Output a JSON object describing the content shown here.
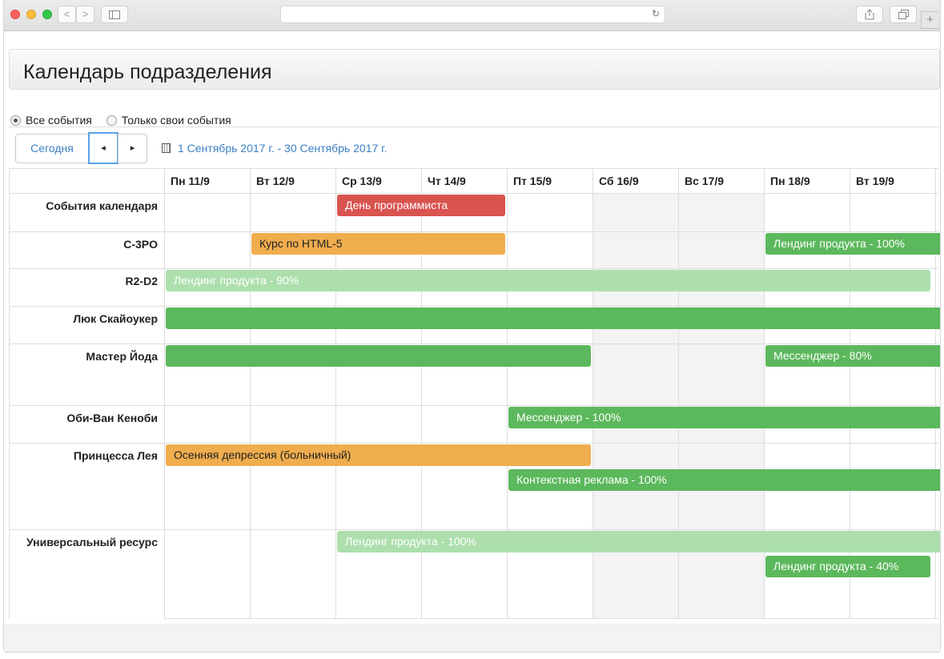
{
  "browser": {
    "url": "",
    "back_label": "<",
    "forward_label": ">",
    "new_tab_label": "+"
  },
  "page": {
    "title": "Календарь подразделения"
  },
  "filters": {
    "all_events": "Все события",
    "own_events": "Только свои события",
    "selected": "all_events"
  },
  "nav": {
    "today": "Сегодня",
    "prev": "◂",
    "next": "▸",
    "range": "1 Сентябрь 2017 г. - 30 Сентябрь 2017 г."
  },
  "calendar": {
    "days": [
      "Пн 11/9",
      "Вт 12/9",
      "Ср 13/9",
      "Чт 14/9",
      "Пт 15/9",
      "Сб 16/9",
      "Вс 17/9",
      "Пн 18/9",
      "Вт 19/9"
    ],
    "weekend_days": [
      "Сб 16/9",
      "Вс 17/9"
    ],
    "resources": [
      "События календаря",
      "C-3PO",
      "R2-D2",
      "Люк Скайоукер",
      "Мастер Йода",
      "Оби-Ван Кеноби",
      "Принцесса Лея",
      "Универсальный ресурс"
    ],
    "events": [
      {
        "resource": "События календаря",
        "title": "День программиста",
        "start": "Ср 13/9",
        "end": "Чт 14/9",
        "color": "#d9534f"
      },
      {
        "resource": "C-3PO",
        "title": "Курс по HTML-5",
        "start": "Вт 12/9",
        "end": "Чт 14/9",
        "color": "#f0ad4e"
      },
      {
        "resource": "C-3PO",
        "title": "Лендинг продукта - 100%",
        "start": "Пн 18/9",
        "end": "Вт 19/9",
        "continues": true,
        "color": "#5cb85c"
      },
      {
        "resource": "R2-D2",
        "title": "Лендинг продукта - 90%",
        "start": "Пн 11/9",
        "end": "Вт 19/9",
        "color": "#addfad"
      },
      {
        "resource": "Люк Скайоукер",
        "title": "",
        "start": "Пн 11/9",
        "end": "Вт 19/9",
        "continues": true,
        "color": "#5cb85c"
      },
      {
        "resource": "Мастер Йода",
        "title": "",
        "start": "Пн 11/9",
        "end": "Пт 15/9",
        "color": "#5cb85c"
      },
      {
        "resource": "Мастер Йода",
        "title": "Мессенджер - 80%",
        "start": "Пн 18/9",
        "end": "Вт 19/9",
        "continues": true,
        "color": "#5cb85c"
      },
      {
        "resource": "Оби-Ван Кеноби",
        "title": "Мессенджер - 100%",
        "start": "Пт 15/9",
        "end": "Вт 19/9",
        "continues": true,
        "color": "#5cb85c"
      },
      {
        "resource": "Принцесса Лея",
        "title": "Осенняя депрессия (больничный)",
        "start": "Пн 11/9",
        "end": "Пт 15/9",
        "color": "#f0ad4e"
      },
      {
        "resource": "Принцесса Лея",
        "title": "Контекстная реклама - 100%",
        "start": "Пт 15/9",
        "end": "Вт 19/9",
        "continues": true,
        "color": "#5cb85c"
      },
      {
        "resource": "Универсальный ресурс",
        "title": "Лендинг продукта - 100%",
        "start": "Ср 13/9",
        "end": "Вт 19/9",
        "continues": true,
        "color": "#addfad"
      },
      {
        "resource": "Универсальный ресурс",
        "title": "Лендинг продукта - 40%",
        "start": "Пн 18/9",
        "end": "Вт 19/9",
        "color": "#5cb85c"
      }
    ]
  }
}
